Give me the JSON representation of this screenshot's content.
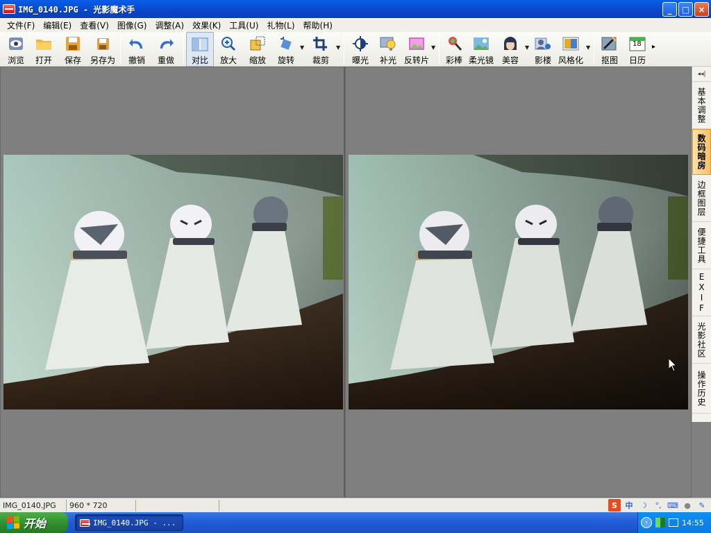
{
  "window": {
    "title": "IMG_0140.JPG - 光影魔术手",
    "minimize": "_",
    "maximize": "□",
    "close": "×"
  },
  "menu": [
    {
      "label": "文件(F)"
    },
    {
      "label": "编辑(E)"
    },
    {
      "label": "查看(V)"
    },
    {
      "label": "图像(G)"
    },
    {
      "label": "调整(A)"
    },
    {
      "label": "效果(K)"
    },
    {
      "label": "工具(U)"
    },
    {
      "label": "礼物(L)"
    },
    {
      "label": "帮助(H)"
    }
  ],
  "toolbar": {
    "browse": "浏览",
    "open": "打开",
    "save": "保存",
    "save_as": "另存为",
    "undo": "撤销",
    "redo": "重做",
    "compare": "对比",
    "zoom_in": "放大",
    "resize": "缩放",
    "rotate": "旋转",
    "crop": "裁剪",
    "exposure": "曝光",
    "fill_light": "补光",
    "reversal": "反转片",
    "color_pen": "彩棒",
    "soft_focus": "柔光镜",
    "beauty": "美容",
    "studio": "影楼",
    "stylize": "风格化",
    "cutout": "抠图",
    "calendar": "日历",
    "calendar_day": "18",
    "more": "▸"
  },
  "sidepanel": {
    "collapse": "◂◂|",
    "tabs": [
      "基本调整",
      "数码暗房",
      "边框图层",
      "便捷工具",
      "EXIF",
      "光影社区",
      "操作历史"
    ]
  },
  "status": {
    "filename": "IMG_0140.JPG",
    "dimensions": "960 * 720",
    "ime_chinese": "中"
  },
  "taskbar": {
    "start": "开始",
    "task": "IMG_0140.JPG - ...",
    "clock": "14:55"
  },
  "colors": {
    "title_blue": "#0a5ee8",
    "start_green": "#2f8a2b",
    "active_tab": "#f7c06b",
    "canvas_gray": "#808080"
  }
}
